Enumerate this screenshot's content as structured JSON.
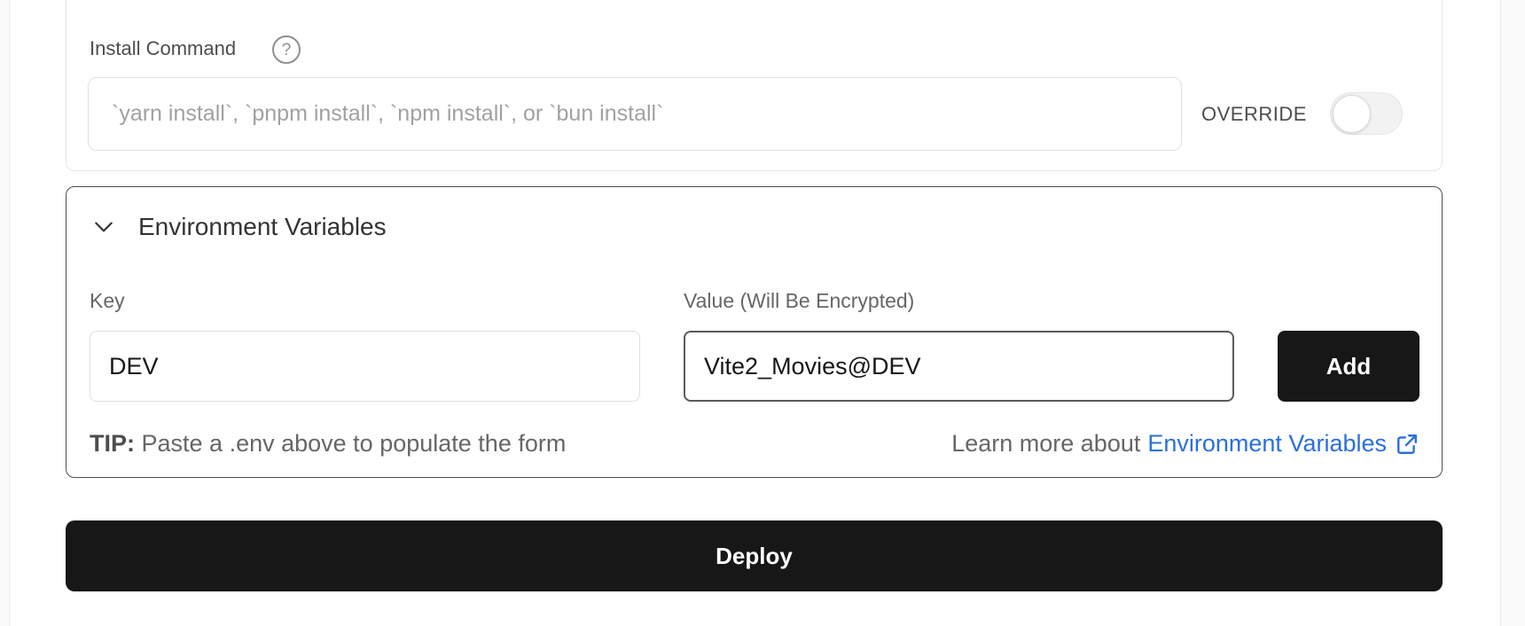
{
  "build_settings": {
    "install_command": {
      "label": "Install Command",
      "placeholder": "`yarn install`, `pnpm install`, `npm install`, or `bun install`",
      "value": "",
      "override_label": "OVERRIDE",
      "override_enabled": false
    }
  },
  "env_vars": {
    "title": "Environment Variables",
    "expanded": true,
    "key_label": "Key",
    "key_value": "DEV",
    "value_label": "Value (Will Be Encrypted)",
    "value_value": "Vite2_Movies@DEV",
    "add_label": "Add",
    "tip_prefix": "TIP:",
    "tip_text": "Paste a .env above to populate the form",
    "learn_more_prefix": "Learn more about",
    "learn_more_link": "Environment Variables"
  },
  "deploy_label": "Deploy",
  "colors": {
    "primary_button": "#171717",
    "link": "#2b6fdc"
  }
}
